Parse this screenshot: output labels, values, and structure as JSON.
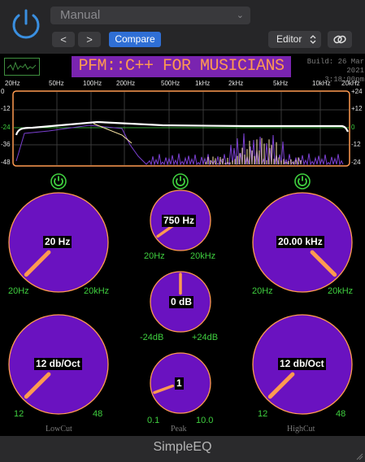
{
  "host": {
    "preset": "Manual",
    "compare_label": "Compare",
    "editor_label": "Editor",
    "prev_label": "<",
    "next_label": ">"
  },
  "header": {
    "title": "PFM::C++ FOR MUSICIANS",
    "build_line1": "Build: 26 Mar 2021",
    "build_line2": "3:18:00pm"
  },
  "analyzer": {
    "freq_labels": [
      "20Hz",
      "50Hz",
      "100Hz",
      "200Hz",
      "500Hz",
      "1kHz",
      "2kHz",
      "5kHz",
      "10kHz",
      "20kHz"
    ],
    "db_left": [
      "0",
      "-12",
      "-24",
      "-36",
      "-48"
    ],
    "db_right": [
      "+24",
      "+12",
      "0",
      "-12",
      "-24"
    ],
    "response_color": "#ffffff",
    "spectrum_colors": [
      "#ffe9a8",
      "#7a3fd0"
    ]
  },
  "knobs": {
    "lowcut_freq": {
      "value_text": "20 Hz",
      "min": "20Hz",
      "max": "20kHz"
    },
    "peak_freq": {
      "value_text": "750 Hz",
      "min": "20Hz",
      "max": "20kHz"
    },
    "highcut_freq": {
      "value_text": "20.00 kHz",
      "min": "20Hz",
      "max": "20kHz"
    },
    "peak_gain": {
      "value_text": "0 dB",
      "min": "-24dB",
      "max": "+24dB"
    },
    "lowcut_slope": {
      "value_text": "12 db/Oct",
      "min": "12",
      "max": "48"
    },
    "peak_quality": {
      "value_text": "1",
      "min": "0.1",
      "max": "10.0"
    },
    "highcut_slope": {
      "value_text": "12 db/Oct",
      "min": "12",
      "max": "48"
    }
  },
  "sections": {
    "lowcut": "LowCut",
    "peak": "Peak",
    "highcut": "HighCut"
  },
  "footer": {
    "title": "SimpleEQ"
  },
  "colors": {
    "knob_fill": "#6a12c0",
    "knob_rim": "#ff9a50",
    "pointer": "#ff9a50",
    "bypass_green": "#3fcf3f",
    "title_bg": "#7a24b0",
    "title_fg": "#ff9a50"
  }
}
